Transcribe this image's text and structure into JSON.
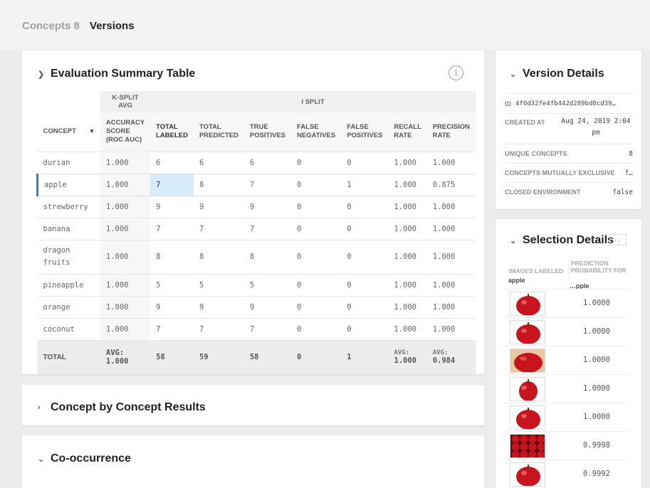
{
  "breadcrumb": {
    "concepts": "Concepts 8",
    "versions": "Versions"
  },
  "eval": {
    "title": "Evaluation Summary Table",
    "group_ksplit": "K-SPLIT AVG",
    "group_split": "I SPLIT",
    "headers": {
      "concept": "CONCEPT",
      "accuracy": "ACCURACY SCORE (ROC AUC)",
      "total_labeled": "TOTAL LABELED",
      "total_predicted": "TOTAL PREDICTED",
      "true_pos": "TRUE POSITIVES",
      "false_neg": "FALSE NEGATIVES",
      "false_pos": "FALSE POSITIVES",
      "recall": "RECALL RATE",
      "precision": "PRECISION RATE"
    },
    "rows": [
      {
        "concept": "durian",
        "acc": "1.000",
        "tl": "6",
        "tp_pred": "6",
        "tpos": "6",
        "fn": "0",
        "fp": "0",
        "recall": "1.000",
        "precision": "1.000"
      },
      {
        "concept": "apple",
        "acc": "1.000",
        "tl": "7",
        "tp_pred": "8",
        "tpos": "7",
        "fn": "0",
        "fp": "1",
        "recall": "1.000",
        "precision": "0.875"
      },
      {
        "concept": "strewberry",
        "acc": "1.000",
        "tl": "9",
        "tp_pred": "9",
        "tpos": "9",
        "fn": "0",
        "fp": "0",
        "recall": "1.000",
        "precision": "1.000"
      },
      {
        "concept": "banana",
        "acc": "1.000",
        "tl": "7",
        "tp_pred": "7",
        "tpos": "7",
        "fn": "0",
        "fp": "0",
        "recall": "1.000",
        "precision": "1.000"
      },
      {
        "concept": "dragon fruits",
        "acc": "1.000",
        "tl": "8",
        "tp_pred": "8",
        "tpos": "8",
        "fn": "0",
        "fp": "0",
        "recall": "1.000",
        "precision": "1.000"
      },
      {
        "concept": "pineapple",
        "acc": "1.000",
        "tl": "5",
        "tp_pred": "5",
        "tpos": "5",
        "fn": "0",
        "fp": "0",
        "recall": "1.000",
        "precision": "1.000"
      },
      {
        "concept": "orange",
        "acc": "1.000",
        "tl": "9",
        "tp_pred": "9",
        "tpos": "9",
        "fn": "0",
        "fp": "0",
        "recall": "1.000",
        "precision": "1.000"
      },
      {
        "concept": "coconut",
        "acc": "1.000",
        "tl": "7",
        "tp_pred": "7",
        "tpos": "7",
        "fn": "0",
        "fp": "0",
        "recall": "1.000",
        "precision": "1.000"
      }
    ],
    "total": {
      "label": "TOTAL",
      "acc": "AVG: 1.000",
      "tl": "58",
      "tp_pred": "59",
      "tpos": "58",
      "fn": "0",
      "fp": "1",
      "recall_prefix": "AVG:",
      "recall": "1.000",
      "precision_prefix": "AVG:",
      "precision": "0.984"
    }
  },
  "concept_results": {
    "title": "Concept by Concept Results"
  },
  "cooccurrence": {
    "title": "Co-occurrence"
  },
  "version": {
    "title": "Version Details",
    "id_label": "ID",
    "id_value": "4f0d32fe4fb442d289bd8cd39…",
    "created_label": "CREATED AT",
    "created_value": "Aug 24, 2019 2:04 pm",
    "unique_label": "UNIQUE CONCEPTS",
    "unique_value": "8",
    "mutex_label": "CONCEPTS MUTUALLY EXCLUSIVE",
    "mutex_value": "f…",
    "closed_label": "CLOSED ENVIRONMENT",
    "closed_value": "false"
  },
  "selection": {
    "title": "Selection Details",
    "col_images": "IMAGES LABELED",
    "col_prob": "PREDICTION PROBABILITY FOR",
    "filter_images": "apple",
    "filter_prob": "…pple",
    "rows": [
      {
        "prob": "1.0000"
      },
      {
        "prob": "1.0000"
      },
      {
        "prob": "1.0000"
      },
      {
        "prob": "1.0000"
      },
      {
        "prob": "1.0000"
      },
      {
        "prob": "0.9998"
      },
      {
        "prob": "0.9992"
      }
    ]
  },
  "colors": {
    "accent": "#3a7bd5",
    "highlight": "#d6ecfb",
    "apple_red": "#c8141e"
  }
}
